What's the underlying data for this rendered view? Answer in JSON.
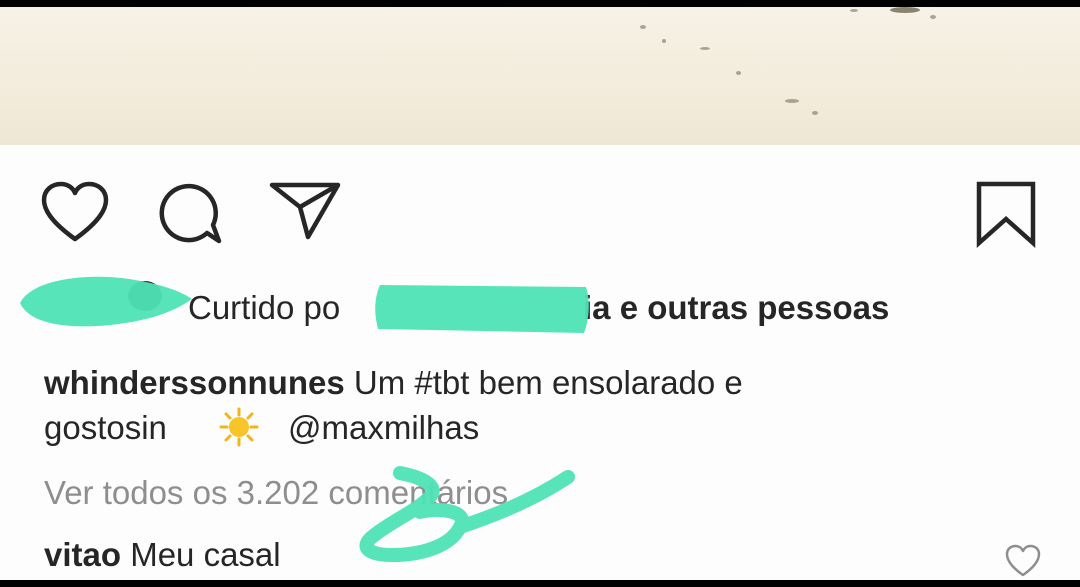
{
  "post": {
    "likes_prefix": "Curtido po",
    "likes_suffix": "ia e outras pessoas",
    "caption_username": "whinderssonnunes",
    "caption_line1": "Um #tbt bem ensolarado e",
    "caption_line2a": "gostosin",
    "caption_mention": "@maxmilhas",
    "view_comments": "Ver todos os 3.202 comentários",
    "comment_username": "vitao",
    "comment_text": "Meu casal"
  },
  "icons": {
    "like": "heart-icon",
    "comment": "comment-bubble-icon",
    "share": "paper-plane-icon",
    "save": "bookmark-icon",
    "comment_like": "small-heart-icon",
    "emoji": "sun-emoji"
  },
  "colors": {
    "text": "#262626",
    "muted": "#8e8e8e",
    "scribble": "#4fe3b5"
  }
}
